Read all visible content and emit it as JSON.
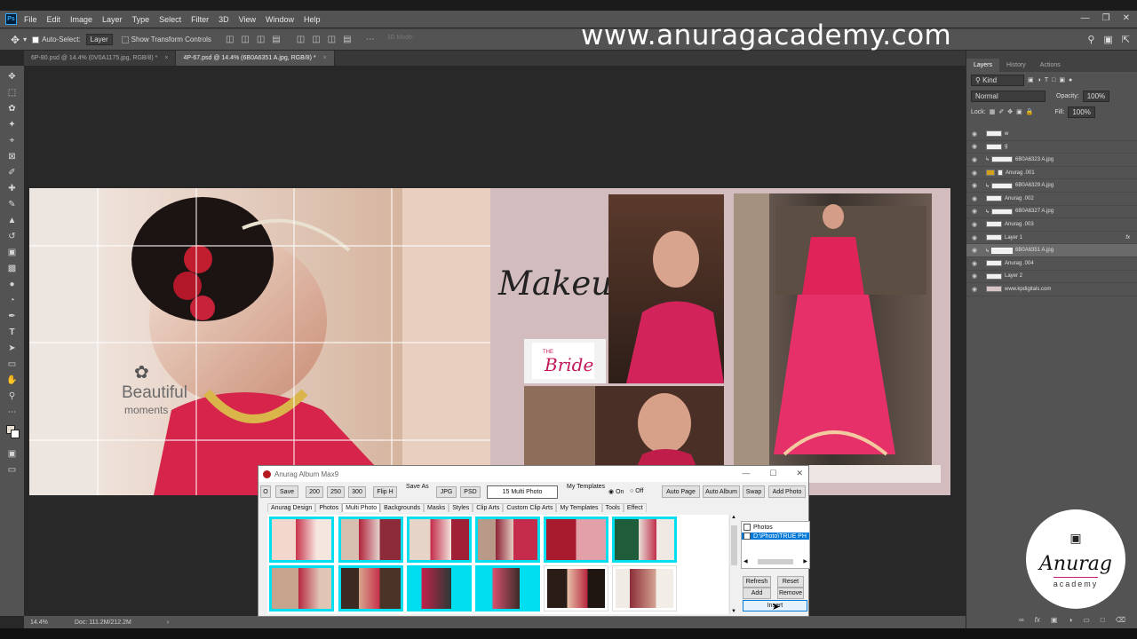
{
  "app": {
    "name": "Ps"
  },
  "menu": [
    "File",
    "Edit",
    "Image",
    "Layer",
    "Type",
    "Select",
    "Filter",
    "3D",
    "View",
    "Window",
    "Help"
  ],
  "options": {
    "auto_select": "Auto-Select:",
    "layer_dd": "Layer",
    "transform": "Show Transform Controls",
    "mode3d": "3D Mode:"
  },
  "watermark": "www.anuragacademy.com",
  "doc_tabs": [
    {
      "label": "6P-80.psd @ 14.4% (0V0A1175.jpg, RGB/8) *"
    },
    {
      "label": "4P-67.psd @ 14.4% (6B0A6351 A.jpg, RGB/8) *"
    }
  ],
  "status": {
    "zoom": "14.4%",
    "doc": "Doc: 111.2M/212.2M"
  },
  "panels": {
    "tabs": [
      "Layers",
      "History",
      "Actions"
    ],
    "kind": "Kind",
    "blend": "Normal",
    "opacity_label": "Opacity:",
    "opacity": "100%",
    "lock_label": "Lock:",
    "fill_label": "Fill:",
    "fill": "100%"
  },
  "layers": [
    {
      "name": "w",
      "type": "plain"
    },
    {
      "name": "g",
      "type": "plain"
    },
    {
      "name": "6B0A6323 A.jpg",
      "type": "clip"
    },
    {
      "name": "Anurag .001",
      "type": "folder"
    },
    {
      "name": "6B0A6329 A.jpg",
      "type": "clip"
    },
    {
      "name": "Anurag .002",
      "type": "plain"
    },
    {
      "name": "6B0A6327 A.jpg",
      "type": "clip"
    },
    {
      "name": "Anurag .003",
      "type": "plain"
    },
    {
      "name": "Layer 1",
      "type": "fx"
    },
    {
      "name": "6B0A6351 A.jpg",
      "type": "selected"
    },
    {
      "name": "Anurag .004",
      "type": "plain"
    },
    {
      "name": "Layer 2",
      "type": "plain"
    },
    {
      "name": "www.kpdigitals.com",
      "type": "pink"
    }
  ],
  "artboard": {
    "beautiful": "Beautiful",
    "moments": "moments",
    "makeup": "Makeup",
    "the": "THE",
    "bride": "Bride"
  },
  "dialog": {
    "title": "Anurag Album Max9",
    "o": "O",
    "save": "Save",
    "s200": "200",
    "s250": "250",
    "s300": "300",
    "fliph": "Flip H",
    "save_as": "Save As",
    "jpg": "JPG",
    "psd": "PSD",
    "multi": "15 Multi Photo",
    "my_templates": "My Templates",
    "on": "On",
    "off": "Off",
    "auto_page": "Auto Page",
    "auto_album": "Auto Album",
    "swap": "Swap",
    "add_photo": "Add Photo",
    "tabs": [
      "Anurag Design",
      "Photos",
      "Multi Photo",
      "Backgrounds",
      "Masks",
      "Styles",
      "Clip Arts",
      "Custom Clip Arts",
      "My Templates",
      "Tools",
      "Effect"
    ],
    "list_items": [
      "Photos",
      "D:\\Photo\\TRUE PH"
    ],
    "refresh": "Refresh",
    "reset": "Reset",
    "add": "Add",
    "remove": "Remove",
    "insert": "Insert"
  },
  "logo": {
    "script": "Anurag",
    "sub": "academy"
  },
  "colors": {
    "ps_gray": "#535353",
    "thumb_cyan": "#00dff0",
    "bride_pink": "#c2185b"
  }
}
